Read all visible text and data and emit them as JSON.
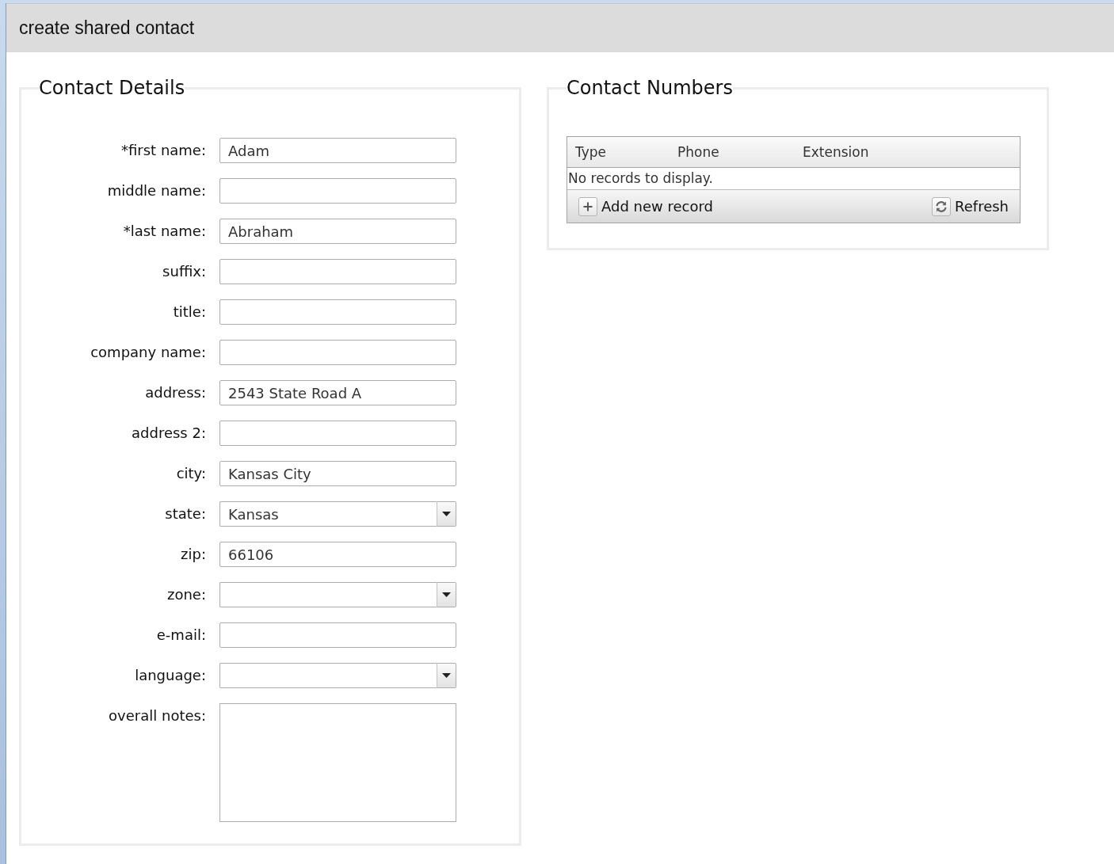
{
  "window": {
    "title": "create shared contact"
  },
  "contact_details": {
    "title": "Contact Details",
    "fields": [
      {
        "label": "*first name:",
        "kind": "text",
        "value": "Adam"
      },
      {
        "label": "middle name:",
        "kind": "text"
      },
      {
        "label": "*last name:",
        "kind": "text",
        "value": "Abraham"
      },
      {
        "label": "suffix:",
        "kind": "text"
      },
      {
        "label": "title:",
        "kind": "text"
      },
      {
        "label": "company name:",
        "kind": "text"
      },
      {
        "label": "address:",
        "kind": "text",
        "value": "2543 State Road A"
      },
      {
        "label": "address 2:",
        "kind": "text"
      },
      {
        "label": "city:",
        "kind": "text",
        "value": "Kansas City"
      },
      {
        "label": "state:",
        "kind": "select",
        "value": "Kansas"
      },
      {
        "label": "zip:",
        "kind": "text",
        "value": "66106"
      },
      {
        "label": "zone:",
        "kind": "select"
      },
      {
        "label": "e-mail:",
        "kind": "text"
      },
      {
        "label": "language:",
        "kind": "select"
      },
      {
        "label": "overall notes:",
        "kind": "textarea"
      }
    ]
  },
  "contact_numbers": {
    "title": "Contact Numbers",
    "table": {
      "columns": [
        "Type",
        "Phone",
        "Extension"
      ],
      "empty_message": "No records to display."
    },
    "toolbar": {
      "add_button": "Add new record",
      "refresh_button": "Refresh"
    }
  }
}
